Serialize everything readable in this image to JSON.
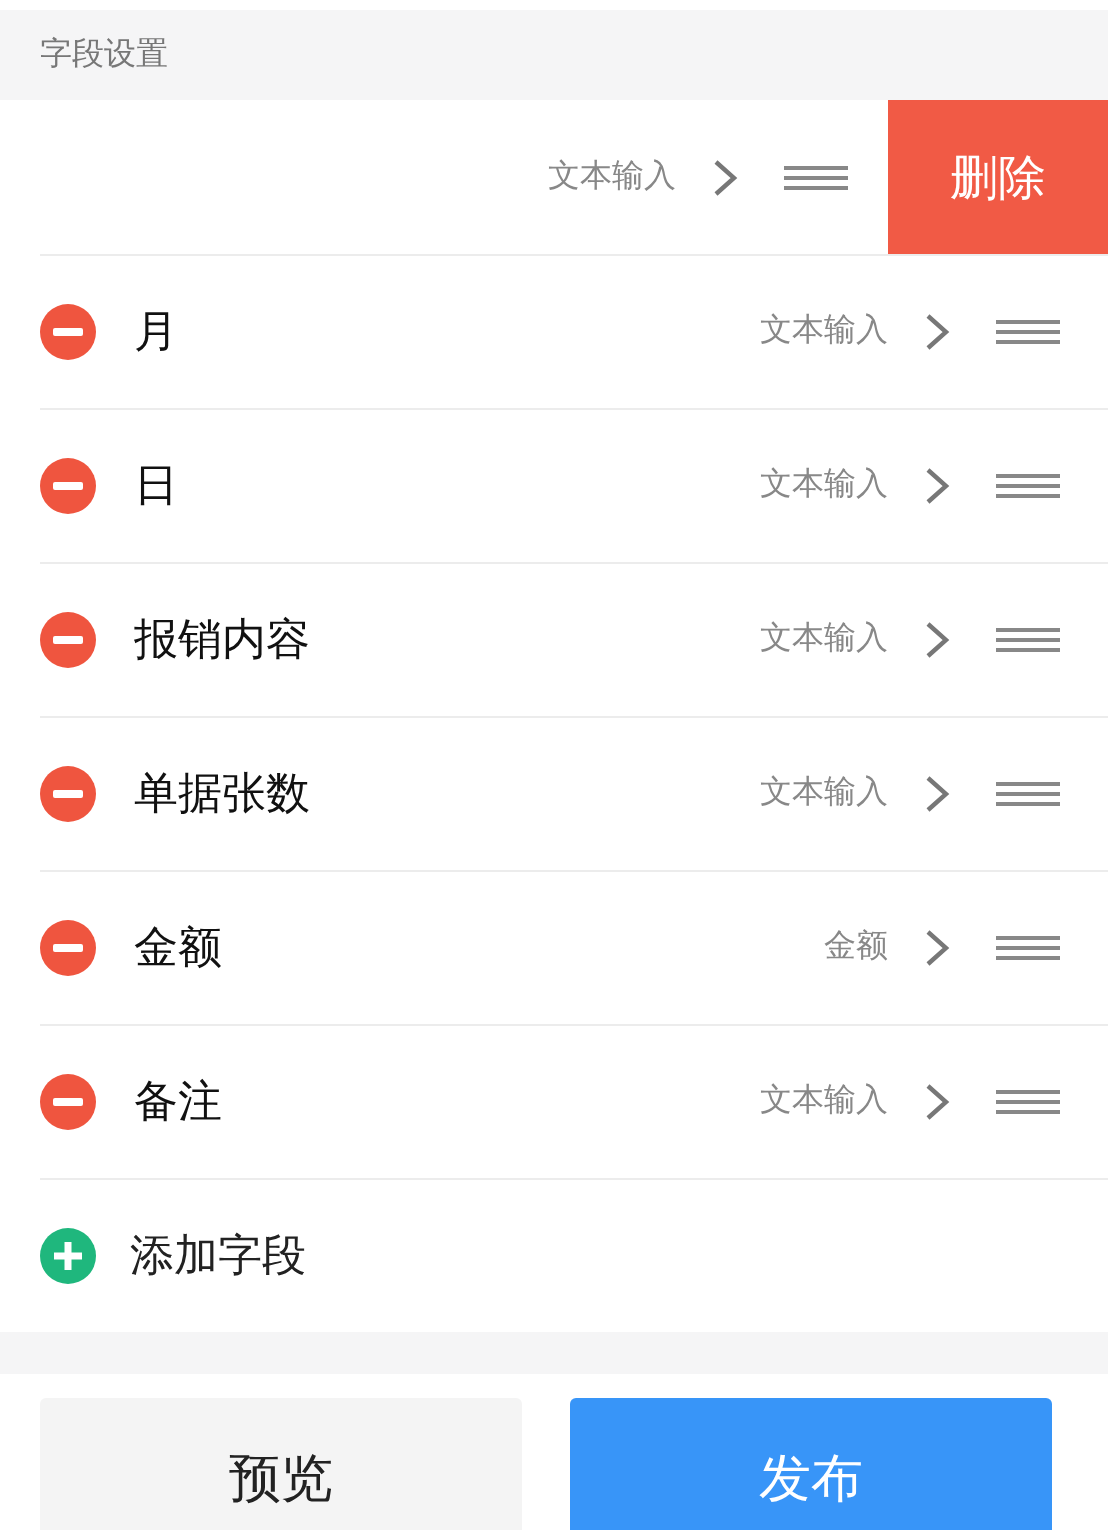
{
  "section_title": "字段设置",
  "fields": [
    {
      "type": "文本输入",
      "swiped": true,
      "delete_label": "删除"
    },
    {
      "name": "月",
      "type": "文本输入",
      "swiped": false
    },
    {
      "name": "日",
      "type": "文本输入",
      "swiped": false
    },
    {
      "name": "报销内容",
      "type": "文本输入",
      "swiped": false
    },
    {
      "name": "单据张数",
      "type": "文本输入",
      "swiped": false
    },
    {
      "name": "金额",
      "type": "金额",
      "swiped": false
    },
    {
      "name": "备注",
      "type": "文本输入",
      "swiped": false
    }
  ],
  "add_field": {
    "label": "添加字段"
  },
  "buttons": [
    {
      "label": "预览",
      "kind": "secondary"
    },
    {
      "label": "发布",
      "kind": "primary"
    }
  ]
}
